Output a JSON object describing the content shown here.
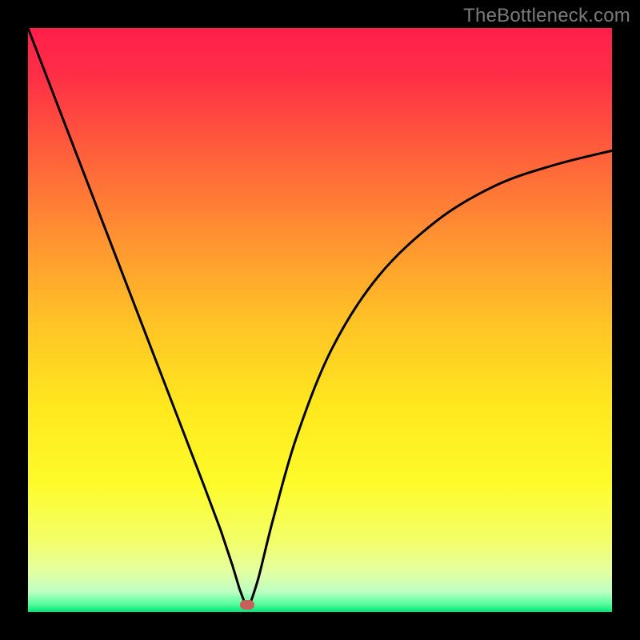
{
  "watermark": "TheBottleneck.com",
  "colors": {
    "frame": "#000000",
    "gradient_stops": [
      {
        "offset": 0.0,
        "color": "#FF1F4B"
      },
      {
        "offset": 0.08,
        "color": "#FF2E46"
      },
      {
        "offset": 0.2,
        "color": "#FF5A3C"
      },
      {
        "offset": 0.35,
        "color": "#FF8F32"
      },
      {
        "offset": 0.5,
        "color": "#FFC226"
      },
      {
        "offset": 0.65,
        "color": "#FFE81E"
      },
      {
        "offset": 0.78,
        "color": "#FEFB2A"
      },
      {
        "offset": 0.88,
        "color": "#F3FF6A"
      },
      {
        "offset": 0.93,
        "color": "#E4FFA0"
      },
      {
        "offset": 0.965,
        "color": "#BEFFC3"
      },
      {
        "offset": 0.985,
        "color": "#5EFF9F"
      },
      {
        "offset": 1.0,
        "color": "#00E57A"
      }
    ],
    "curve": "#000000",
    "marker": "#C66058"
  },
  "chart_data": {
    "type": "line",
    "title": "",
    "xlabel": "",
    "ylabel": "",
    "xlim": [
      0,
      1
    ],
    "ylim": [
      0,
      1
    ],
    "grid": false,
    "note": "Axes/ticks not shown in image; x and y normalized 0–1 within the plot area. y=0 at bottom, y=1 at top.",
    "marker": {
      "x": 0.375,
      "y": 0.013
    },
    "series": [
      {
        "name": "left-branch",
        "x": [
          0.0,
          0.05,
          0.1,
          0.15,
          0.2,
          0.25,
          0.3,
          0.33,
          0.35,
          0.362,
          0.372
        ],
        "y": [
          1.0,
          0.87,
          0.74,
          0.61,
          0.48,
          0.35,
          0.22,
          0.14,
          0.08,
          0.04,
          0.013
        ]
      },
      {
        "name": "right-branch",
        "x": [
          0.38,
          0.395,
          0.42,
          0.46,
          0.52,
          0.6,
          0.7,
          0.8,
          0.9,
          1.0
        ],
        "y": [
          0.013,
          0.06,
          0.16,
          0.3,
          0.45,
          0.575,
          0.67,
          0.73,
          0.765,
          0.79
        ]
      }
    ]
  }
}
